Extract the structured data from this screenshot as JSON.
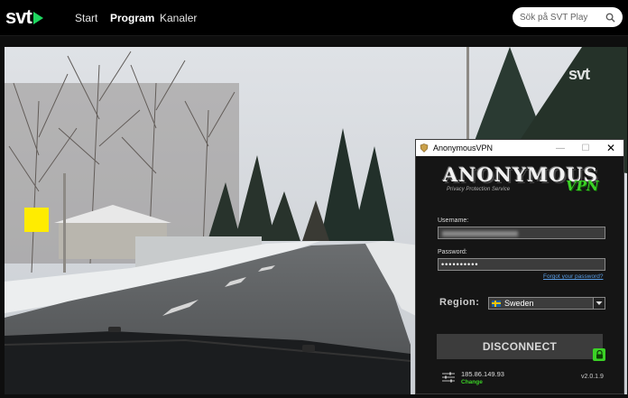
{
  "header": {
    "logo_text": "svt",
    "nav": [
      "Start",
      "Program",
      "Kanaler"
    ],
    "active_nav": "Program",
    "search_placeholder": "Sök på SVT Play"
  },
  "player": {
    "watermark": "svt",
    "scene": "snowy road"
  },
  "vpn": {
    "window_title": "AnonymousVPN",
    "logo_main": "ANONYMOUS",
    "logo_sub": "Privacy Protection Service",
    "logo_vpn": "VPN",
    "username_label": "Username:",
    "password_label": "Password:",
    "password_mask": "••••••••••",
    "forgot_link": "Forgot your password?",
    "region_label": "Region:",
    "region_value": "Sweden",
    "disconnect_label": "DISCONNECT",
    "ip_address": "185.86.149.93",
    "change_label": "Change",
    "version": "v2.0.1.9"
  },
  "colors": {
    "svt_green": "#1ed760",
    "vpn_green": "#3bd126",
    "link_blue": "#5a9ee6",
    "marker_yellow": "#ffec00"
  }
}
